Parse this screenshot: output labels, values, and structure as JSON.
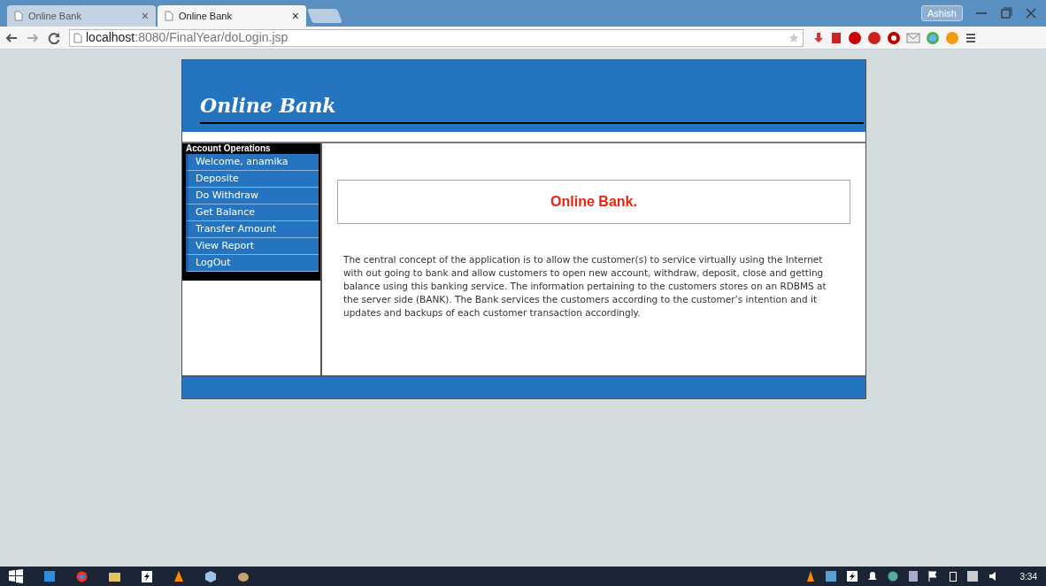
{
  "browser": {
    "tabs": [
      {
        "label": "Online Bank",
        "selected": false
      },
      {
        "label": "Online Bank",
        "selected": true
      }
    ],
    "close_glyph": "×",
    "profile": "Ashish",
    "address": {
      "host": "localhost",
      "path": ":8080/FinalYear/doLogin.jsp"
    }
  },
  "site": {
    "title": "Online Bank",
    "sidebar": {
      "heading": "Account Operations",
      "items": [
        "Welcome, anamika",
        "Deposite",
        "Do Withdraw",
        "Get Balance",
        "Transfer Amount",
        "View Report",
        "LogOut"
      ]
    },
    "banner": "Online Bank.",
    "description": "The central concept of the application is to allow the customer(s) to service virtually using the Internet with out going to bank and allow customers to open new account, withdraw, deposit, close and getting balance using this banking service.  The information pertaining to the customers stores on an RDBMS at the server side (BANK).  The Bank services the customers according to the customer’s intention and it updates and backups of each customer transaction accordingly."
  },
  "taskbar": {
    "clock": "3:34"
  }
}
